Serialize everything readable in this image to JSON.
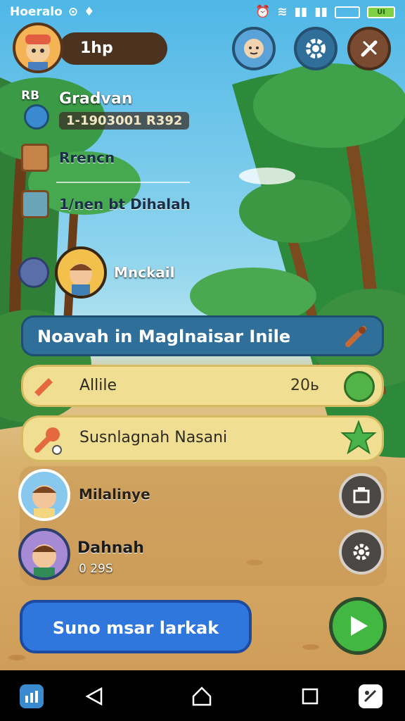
{
  "status_bar": {
    "carrier": "Hoeralo",
    "battery_text": "UI"
  },
  "header": {
    "hp": "1hp"
  },
  "profile": {
    "header": "RB",
    "name": "Gradvan",
    "subtitle": "1-1903001 R392"
  },
  "menu": {
    "item1": "Rrencn",
    "item2": "1/nen bt Dihalah",
    "item3": "Mnckail"
  },
  "banner": {
    "title": "Noavah in Maglnaisar Inile"
  },
  "tasks": [
    {
      "label": "Allile",
      "value": "20ь"
    },
    {
      "label": "Susnlagnah Nasani"
    }
  ],
  "players": [
    {
      "name": "Milalinye"
    },
    {
      "name": "Dahnah",
      "value": "0 29S"
    }
  ],
  "footer": {
    "button_label": "Suno msar larkak"
  },
  "colors": {
    "banner": "#2f6f9a",
    "pill": "#f0df92",
    "play": "#42b843",
    "footer_button": "#2f76dd"
  }
}
